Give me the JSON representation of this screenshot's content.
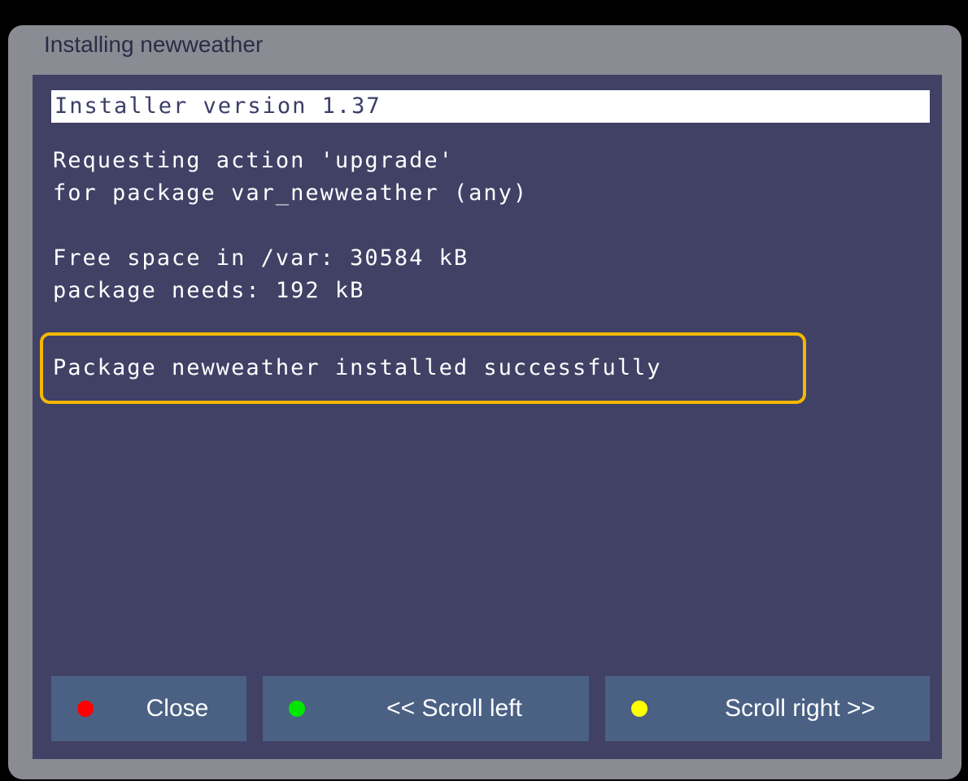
{
  "window": {
    "title": "Installing newweather"
  },
  "log": {
    "version_line": "Installer version 1.37",
    "lines": [
      "Requesting action 'upgrade'",
      "for package var_newweather (any)",
      "Free space in /var: 30584 kB",
      "package needs: 192 kB"
    ],
    "success_line": "Package newweather installed successfully"
  },
  "buttons": {
    "close": {
      "label": "Close",
      "dot_color": "#ff0000"
    },
    "scroll_left": {
      "label": "<< Scroll left",
      "dot_color": "#00e600"
    },
    "scroll_right": {
      "label": "Scroll right >>",
      "dot_color": "#ffff00"
    }
  },
  "colors": {
    "window_frame": "#8a8b93",
    "panel_background": "#414166",
    "button_background": "#4a6184",
    "highlight_border": "#f5b800"
  }
}
